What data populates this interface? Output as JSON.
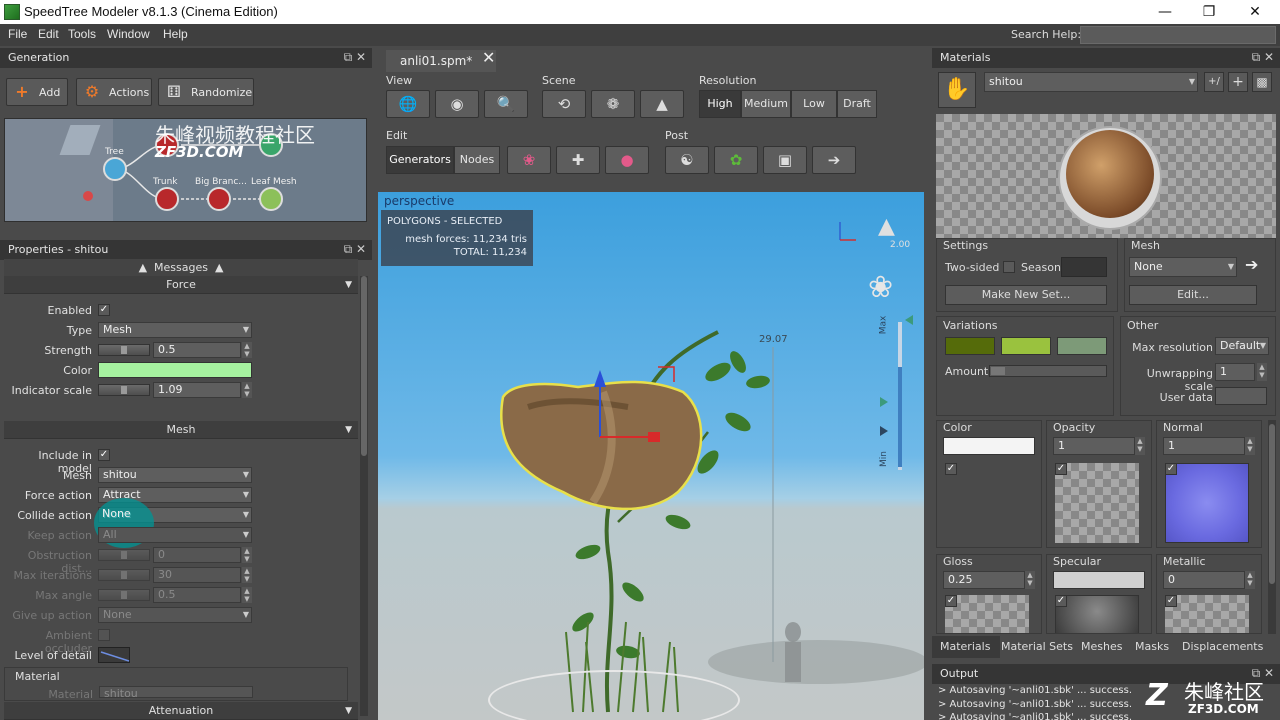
{
  "window": {
    "title": "SpeedTree Modeler v8.1.3 (Cinema Edition)"
  },
  "menu": [
    "File",
    "Edit",
    "Tools",
    "Window",
    "Help"
  ],
  "search": {
    "label": "Search Help:"
  },
  "generation": {
    "title": "Generation",
    "buttons": {
      "add": "Add",
      "actions": "Actions",
      "randomize": "Randomize"
    },
    "nodes": {
      "tree": "Tree",
      "trunk": "Trunk",
      "big_branch": "Big Branc...",
      "leaf_mesh": "Leaf Mesh"
    },
    "watermark_cn": "朱峰视频教程社区",
    "watermark_en": "ZF3D.COM"
  },
  "properties": {
    "title": "Properties - shitou",
    "messages": "Messages",
    "force_section": "Force",
    "enabled_label": "Enabled",
    "type_label": "Type",
    "type_value": "Mesh",
    "strength_label": "Strength",
    "strength_value": "0.5",
    "color_label": "Color",
    "color_hex": "#a6f2a0",
    "indicator_label": "Indicator scale",
    "indicator_value": "1.09",
    "mesh_section": "Mesh",
    "include_label": "Include in model",
    "mesh_label": "Mesh",
    "mesh_value": "shitou",
    "force_action_label": "Force action",
    "force_action_value": "Attract",
    "collide_label": "Collide action",
    "collide_value": "None",
    "keep_label": "Keep action",
    "keep_value": "All",
    "obstruction_label": "Obstruction dist...",
    "obstruction_value": "0",
    "max_iter_label": "Max iterations",
    "max_iter_value": "30",
    "max_angle_label": "Max angle",
    "max_angle_value": "0.5",
    "giveup_label": "Give up action",
    "giveup_value": "None",
    "ambient_label": "Ambient occluder",
    "lod_label": "Level of detail",
    "material_group": "Material",
    "material_label": "Material",
    "material_value": "shitou",
    "attenuation_section": "Attenuation"
  },
  "document": {
    "tab": "anli01.spm*"
  },
  "toolbar": {
    "view": "View",
    "scene": "Scene",
    "resolution": "Resolution",
    "res_options": [
      "High",
      "Medium",
      "Low",
      "Draft"
    ],
    "edit": "Edit",
    "generators": "Generators",
    "nodes": "Nodes",
    "post": "Post"
  },
  "viewport": {
    "mode": "perspective",
    "stats_title": "POLYGONS - SELECTED",
    "mesh_forces": "mesh forces: 11,234 tris",
    "total": "TOTAL: 11,234",
    "light_value": "2.00",
    "height_marker": "29.07",
    "max": "Max",
    "min": "Min"
  },
  "materials": {
    "title": "Materials",
    "current": "shitou",
    "settings": "Settings",
    "two_sided": "Two-sided",
    "season": "Season",
    "make_new_set": "Make New Set...",
    "mesh": "Mesh",
    "mesh_value": "None",
    "edit": "Edit...",
    "variations": "Variations",
    "amount": "Amount",
    "variation_colors": [
      "#556b0a",
      "#9ac23e",
      "#7d9a78"
    ],
    "other": "Other",
    "max_res_label": "Max resolution",
    "max_res_value": "Default",
    "unwrap_label": "Unwrapping scale",
    "unwrap_value": "1",
    "user_data": "User data",
    "color": "Color",
    "opacity": "Opacity",
    "opacity_value": "1",
    "normal": "Normal",
    "normal_value": "1",
    "gloss": "Gloss",
    "gloss_value": "0.25",
    "specular": "Specular",
    "metallic": "Metallic",
    "metallic_value": "0",
    "tabs": [
      "Materials",
      "Material Sets",
      "Meshes",
      "Masks",
      "Displacements"
    ]
  },
  "output": {
    "title": "Output",
    "lines": [
      "> Autosaving '~anli01.sbk' ... success.",
      "> Autosaving '~anli01.sbk' ... success.",
      "> Autosaving '~anli01.sbk' ... success."
    ],
    "brand_cn": "朱峰社区",
    "brand_en": "ZF3D.COM"
  }
}
